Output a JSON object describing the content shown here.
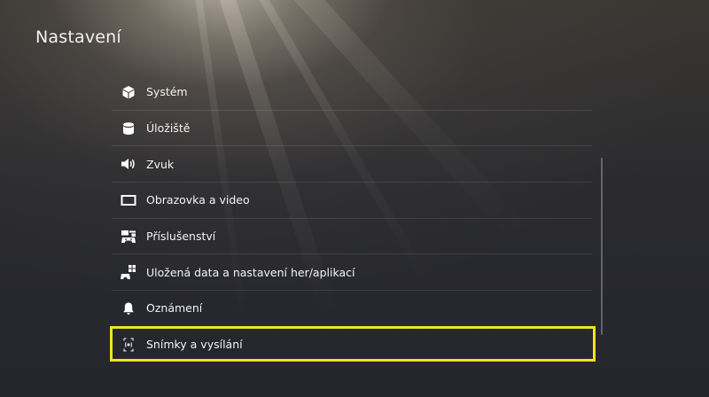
{
  "page": {
    "title": "Nastavení"
  },
  "menu": {
    "items": [
      {
        "label": "Systém",
        "icon": "system-cube-icon"
      },
      {
        "label": "Úložiště",
        "icon": "storage-icon"
      },
      {
        "label": "Zvuk",
        "icon": "speaker-icon"
      },
      {
        "label": "Obrazovka a video",
        "icon": "screen-icon"
      },
      {
        "label": "Příslušenství",
        "icon": "accessories-icon"
      },
      {
        "label": "Uložená data a nastavení her/aplikací",
        "icon": "saved-data-icon"
      },
      {
        "label": "Oznámení",
        "icon": "bell-icon"
      },
      {
        "label": "Snímky a vysílání",
        "icon": "capture-broadcast-icon"
      }
    ],
    "selected_index": 7
  },
  "colors": {
    "highlight": "#f1e320",
    "text": "#f4f4f4"
  }
}
